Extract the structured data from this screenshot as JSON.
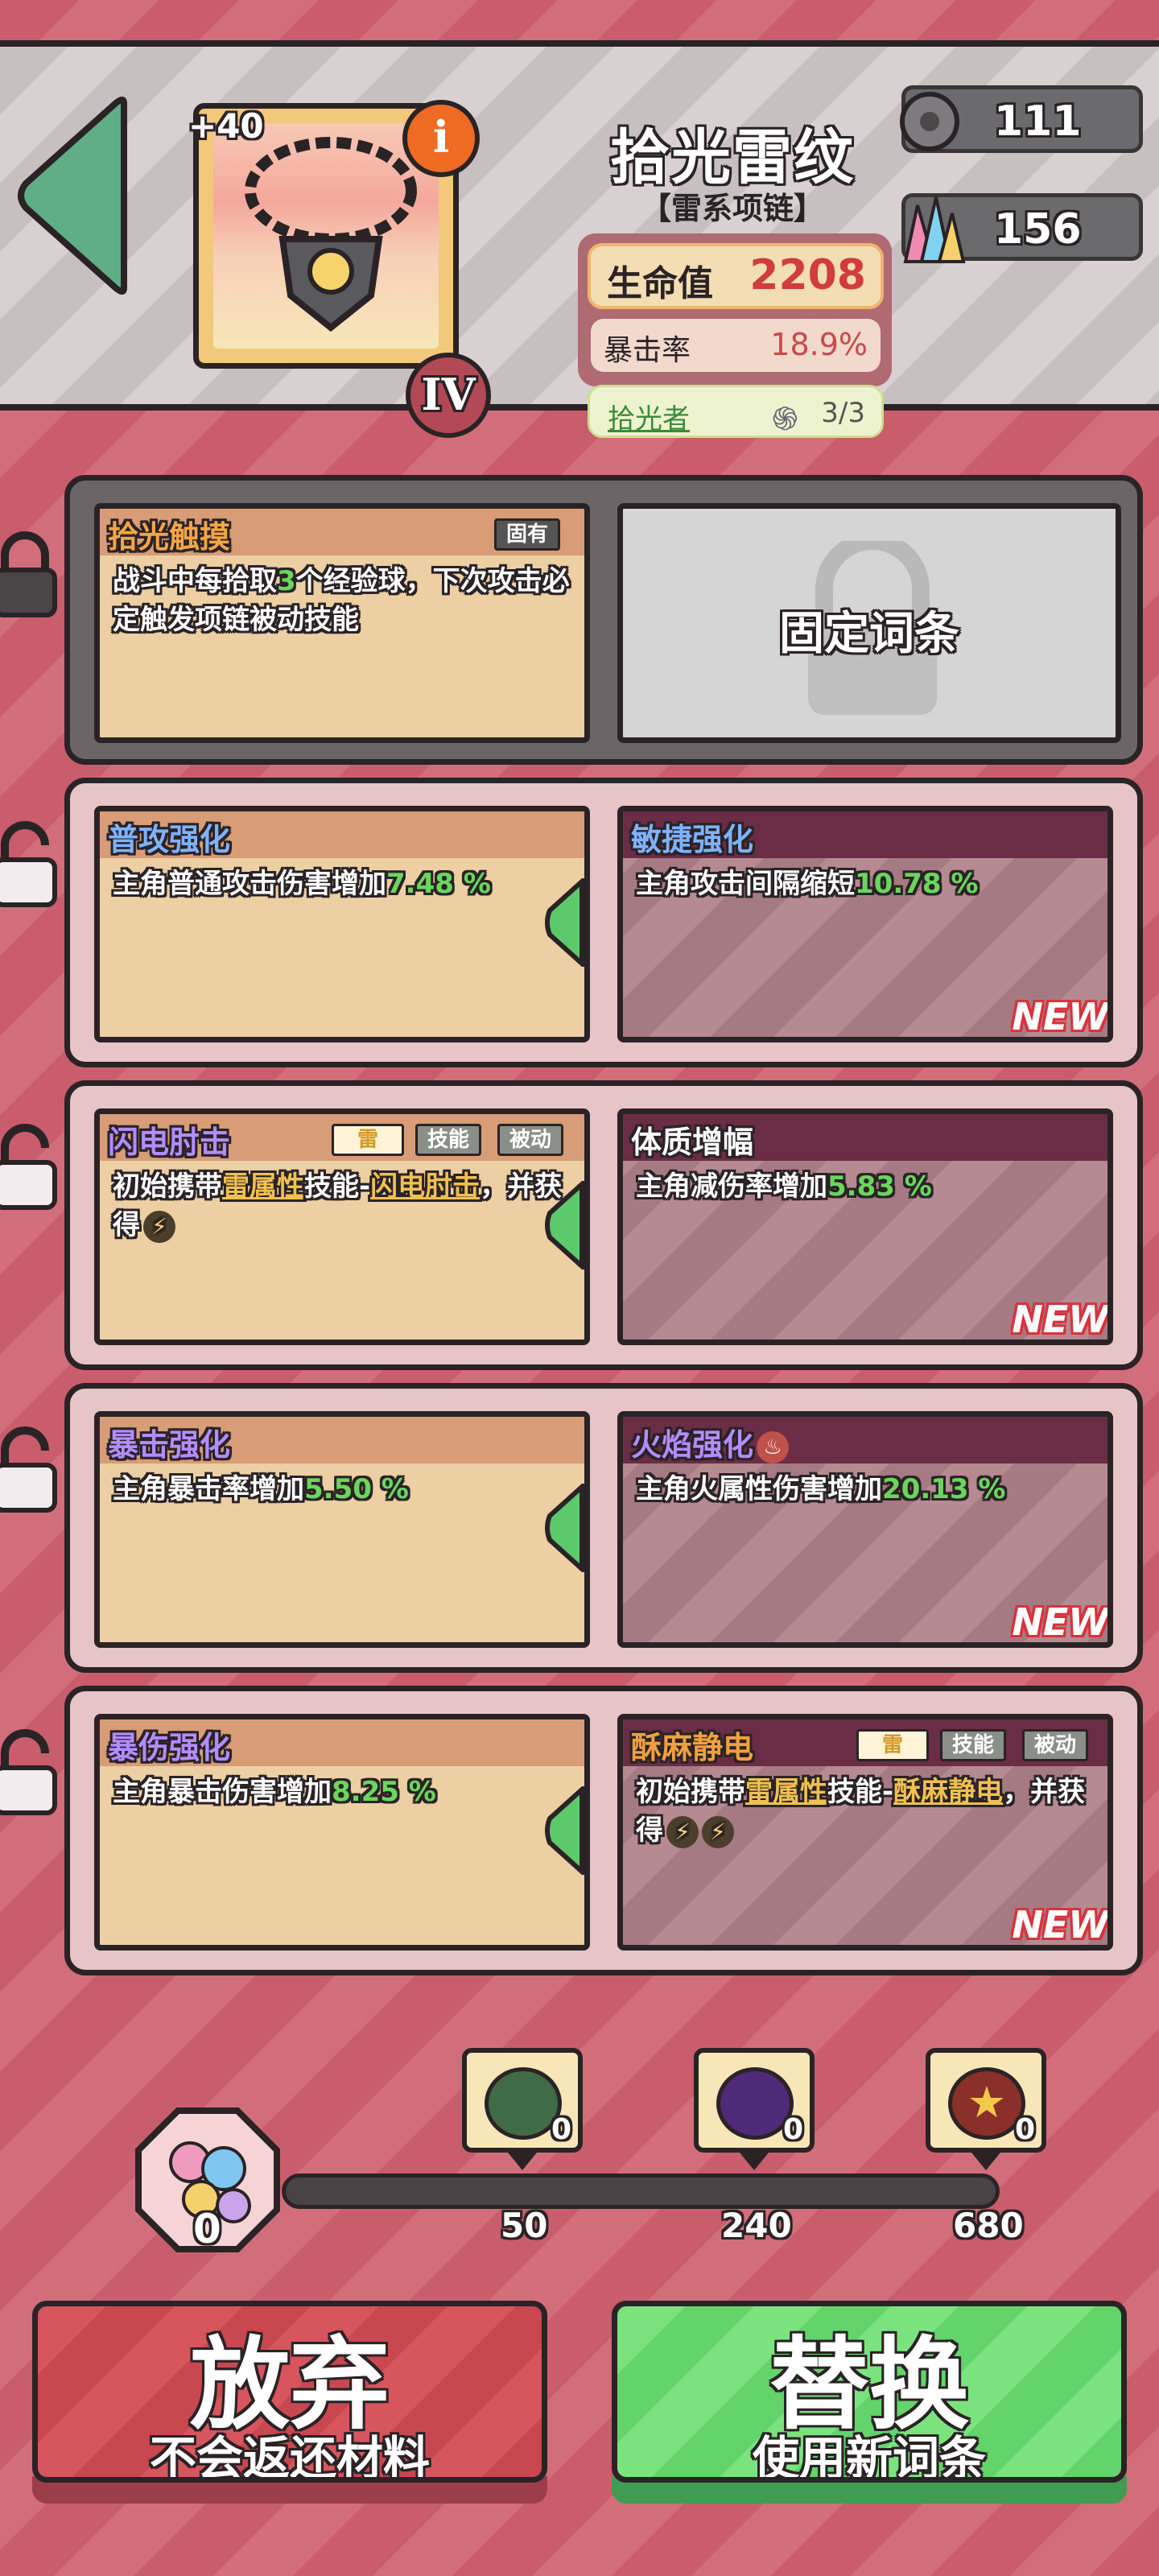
{
  "header": {
    "item_level_bonus": "+40",
    "item_name": "拾光雷纹",
    "item_type": "【雷系项链】",
    "tier": "IV",
    "info_icon": "i",
    "stats": [
      {
        "label": "生命值",
        "value": "2208"
      },
      {
        "label": "暴击率",
        "value": "18.9%"
      }
    ],
    "set": {
      "label": "拾光者",
      "count": "3/3"
    },
    "resources": [
      {
        "icon": "gear-ore-icon",
        "value": "111"
      },
      {
        "icon": "crystal-icon",
        "value": "156"
      }
    ]
  },
  "fixed_row": {
    "old": {
      "title": "拾光触摸",
      "tag": "固有",
      "desc_parts": [
        "战斗中每拾取",
        "3",
        "个经验球，下次攻击必定触发项链被动技能"
      ]
    },
    "new_label": "固定词条"
  },
  "rows": [
    {
      "old": {
        "title": "普攻强化",
        "title_color": "#7fb2ff",
        "desc": "主角普通攻击伤害增加",
        "value": "7.48 %"
      },
      "new": {
        "title": "敏捷强化",
        "title_color": "#7fb2ff",
        "desc": "主角攻击间隔缩短",
        "value": "10.78 %"
      },
      "new_badge": "NEW"
    },
    {
      "old": {
        "title": "闪电肘击",
        "title_color": "#b38cff",
        "tags": [
          "雷",
          "技能",
          "被动"
        ],
        "desc_a": "初始携带",
        "desc_b": "雷属性",
        "desc_c": "技能-",
        "desc_d": "闪电肘击",
        "desc_e": "，并获得"
      },
      "new": {
        "title": "体质增幅",
        "title_color": "#ffffff",
        "desc": "主角减伤率增加",
        "value": "5.83 %"
      },
      "new_badge": "NEW"
    },
    {
      "old": {
        "title": "暴击强化",
        "title_color": "#b38cff",
        "desc": "主角暴击率增加",
        "value": "5.50 %"
      },
      "new": {
        "title": "火焰强化",
        "title_color": "#b38cff",
        "desc": "主角火属性伤害增加",
        "value": "20.13 %"
      },
      "new_badge": "NEW"
    },
    {
      "old": {
        "title": "暴伤强化",
        "title_color": "#b38cff",
        "desc": "主角暴击伤害增加",
        "value": "8.25 %"
      },
      "new": {
        "title": "酥麻静电",
        "title_color": "#f0a040",
        "tags": [
          "雷",
          "技能",
          "被动"
        ],
        "desc_a": "初始携带",
        "desc_b": "雷属性",
        "desc_c": "技能-",
        "desc_d": "酥麻静电",
        "desc_e": "，并获得"
      },
      "new_badge": "NEW"
    }
  ],
  "materials": {
    "current": "0",
    "milestones": [
      {
        "label": "50",
        "count": "0",
        "gem": "green-gem-icon",
        "color": "#3f6b45"
      },
      {
        "label": "240",
        "count": "0",
        "gem": "purple-gem-icon",
        "color": "#4e2a78"
      },
      {
        "label": "680",
        "count": "0",
        "gem": "red-star-gem-icon",
        "color": "#8a2f2a"
      }
    ]
  },
  "buttons": {
    "abandon": {
      "big": "放弃",
      "small": "不会返还材料"
    },
    "replace": {
      "big": "替换",
      "small": "使用新词条"
    }
  },
  "colors": {
    "highlight": "#6bd65d",
    "new_badge": "#d8333c",
    "accent_red": "#d03c40"
  }
}
